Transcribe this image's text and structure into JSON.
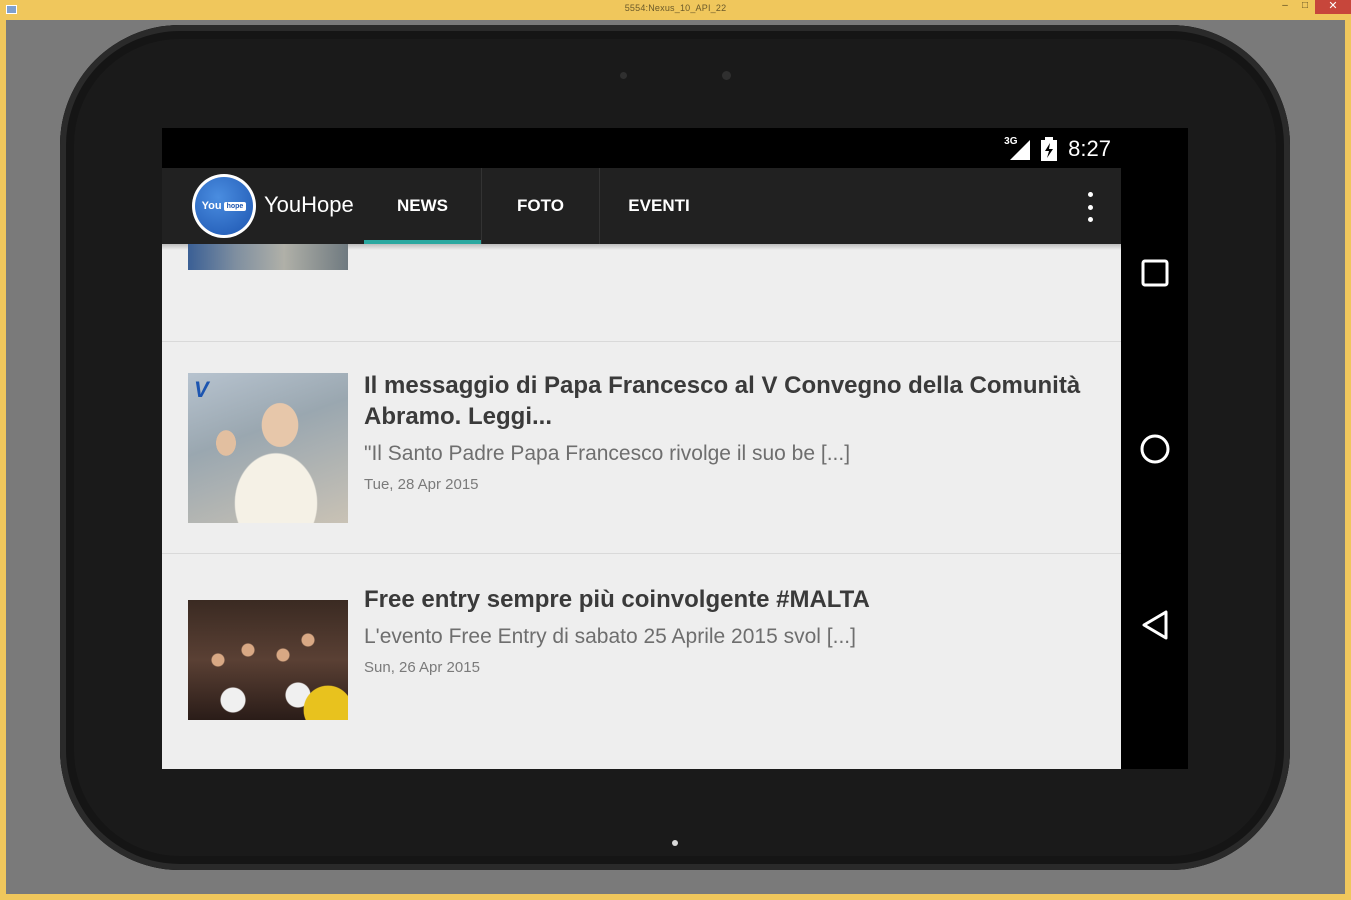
{
  "window": {
    "title": "5554:Nexus_10_API_22",
    "minimize": "–",
    "maximize": "□",
    "close": "✕"
  },
  "status_bar": {
    "network": "3G",
    "time": "8:27"
  },
  "app_bar": {
    "logo_text_you": "You",
    "logo_text_hope": "hope",
    "title": "YouHope",
    "tabs": [
      {
        "label": "NEWS",
        "active": true
      },
      {
        "label": "FOTO",
        "active": false
      },
      {
        "label": "EVENTI",
        "active": false
      }
    ]
  },
  "news": [
    {
      "title": "Il messaggio di Papa Francesco al V Convegno della Comunità Abramo. Leggi...",
      "excerpt": "\"Il Santo Padre Papa Francesco  rivolge il suo be [...]",
      "date": "Tue, 28 Apr 2015",
      "thumb_badge": "V"
    },
    {
      "title": "Free entry sempre più coinvolgente #MALTA",
      "excerpt": "L'evento Free Entry di sabato 25 Aprile 2015 svol [...]",
      "date": "Sun, 26 Apr 2015"
    }
  ],
  "colors": {
    "app_bar": "#212121",
    "tab_indicator": "#2aa8a0",
    "content_bg": "#eeeeee",
    "window_frame": "#f0c75c"
  }
}
